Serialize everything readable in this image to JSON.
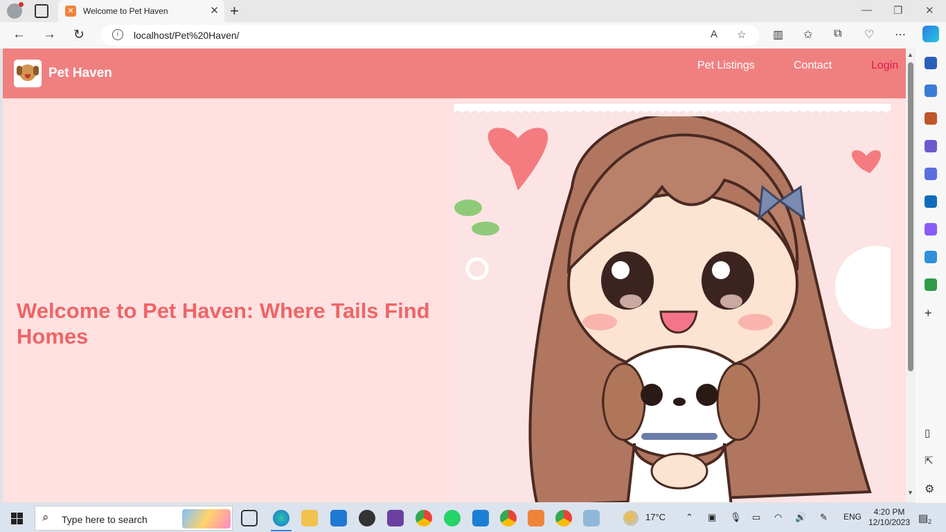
{
  "browser": {
    "tab_title": "Welcome to Pet Haven",
    "url": "localhost/Pet%20Haven/",
    "read_aloud_label": "A",
    "window_controls": [
      "minimize-icon",
      "restore-icon",
      "close-icon"
    ]
  },
  "site": {
    "brand": "Pet Haven",
    "nav": {
      "pet_listings": "Pet Listings",
      "contact": "Contact",
      "login": "Login"
    },
    "hero": {
      "title": "Welcome to Pet Haven: Where Tails Find Homes"
    },
    "colors": {
      "header": "#f08080",
      "background": "#ffe1e2",
      "title": "#ef6565",
      "login": "#e0174a"
    }
  },
  "taskbar": {
    "search_placeholder": "Type here to search",
    "weather_temp": "17°C",
    "language": "ENG",
    "time": "4:20 PM",
    "date": "12/10/2023",
    "notification_count": "2"
  }
}
